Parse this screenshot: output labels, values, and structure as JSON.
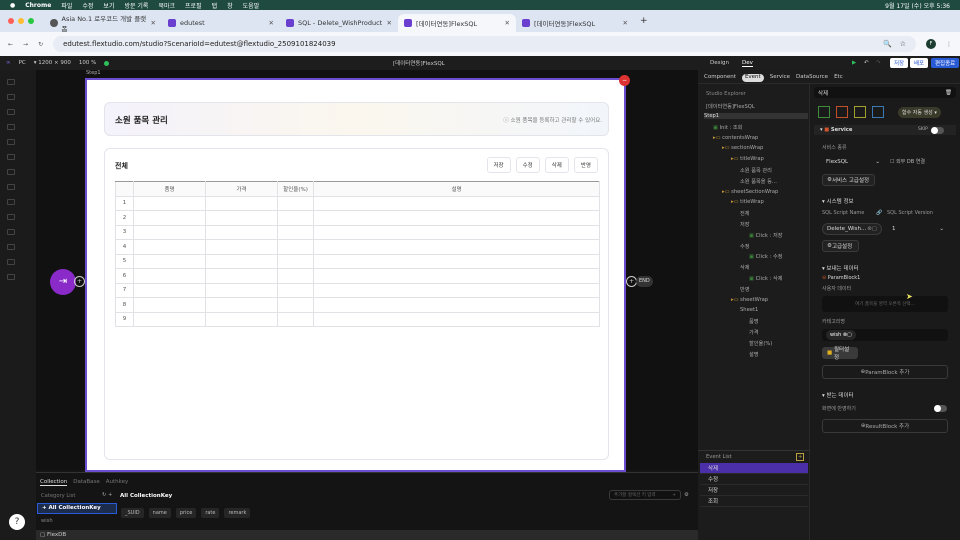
{
  "menubar": {
    "app": "Chrome",
    "items": [
      "파일",
      "수정",
      "보기",
      "방문 기록",
      "북마크",
      "프로필",
      "탭",
      "창",
      "도움말"
    ],
    "clock": "9월 17일 (수) 오후 5:36"
  },
  "tabs": [
    {
      "label": "Asia No.1 로우코드 개발 플랫폼"
    },
    {
      "label": "edutest"
    },
    {
      "label": "SQL - Delete_WishProduct"
    },
    {
      "label": "[데이터연동]FlexSQL",
      "active": true
    },
    {
      "label": "[데이터연동]FlexSQL"
    }
  ],
  "address": {
    "url": "edutest.flextudio.com/studio?ScenarioId=edutest@flextudio_2509101824039",
    "profile": "F"
  },
  "apptop": {
    "device": "PC",
    "resolution": "1200 × 900",
    "zoom": "100",
    "zoom_unit": "%",
    "title": "[데이터연동]FlexSQL",
    "mode_tabs": [
      "Design",
      "Dev"
    ],
    "active_mode": "Dev",
    "save": "저장",
    "deploy": "배포",
    "finish": "편집종료"
  },
  "canvas": {
    "step_label": "Step1",
    "end_label": "END"
  },
  "page": {
    "title": "소원 품목 관리",
    "subtitle": "소원 품목을 등록하고 관리할 수 있어요.",
    "section_title": "전체",
    "buttons": [
      "저장",
      "수정",
      "삭제",
      "반영"
    ],
    "columns": [
      "",
      "품명",
      "가격",
      "할인율(%)",
      "설명"
    ],
    "rows": [
      "1",
      "2",
      "3",
      "4",
      "5",
      "6",
      "7",
      "8",
      "9"
    ]
  },
  "bottom": {
    "tabs": [
      "Collection",
      "DataBase",
      "Authkey"
    ],
    "category_label": "Category List",
    "categories": [
      "All CollectionKey",
      "wish"
    ],
    "heading": "All CollectionKey",
    "fields": [
      "_SUID",
      "name",
      "price",
      "rate",
      "remark"
    ],
    "key_placeholder": "추가할 컬렉션 키 입력"
  },
  "footer": {
    "label": "FlexDB"
  },
  "explorer": {
    "tabs": [
      "Component",
      "Event",
      "Service",
      "DataSource",
      "Etc"
    ],
    "active_tab": "Event",
    "title": "Studio Explorer",
    "root": "[데이터연동]FlexSQL",
    "tree": [
      {
        "t": "Step1",
        "d": 0
      },
      {
        "t": "Init : 조회",
        "d": 1
      },
      {
        "t": "contentsWrap",
        "d": 1
      },
      {
        "t": "sectionWrap",
        "d": 2
      },
      {
        "t": "titleWrap",
        "d": 3
      },
      {
        "t": "소원 품목 관리",
        "d": 4
      },
      {
        "t": "소원 품목을 등...",
        "d": 4
      },
      {
        "t": "sheetSectionWrap",
        "d": 2
      },
      {
        "t": "titleWrap",
        "d": 3
      },
      {
        "t": "전체",
        "d": 4
      },
      {
        "t": "저장",
        "d": 4
      },
      {
        "t": "Click : 저장",
        "d": 5
      },
      {
        "t": "수정",
        "d": 4
      },
      {
        "t": "Click : 수정",
        "d": 5
      },
      {
        "t": "삭제",
        "d": 4
      },
      {
        "t": "Click : 삭제",
        "d": 5
      },
      {
        "t": "반영",
        "d": 4
      },
      {
        "t": "sheetWrap",
        "d": 3
      },
      {
        "t": "Sheet1",
        "d": 4
      },
      {
        "t": "품명",
        "d": 5
      },
      {
        "t": "가격",
        "d": 5
      },
      {
        "t": "할인율(%)",
        "d": 5
      },
      {
        "t": "설명",
        "d": 5
      }
    ],
    "event_list_title": "Event List",
    "events": [
      "삭제",
      "수정",
      "저장",
      "조회"
    ],
    "selected_event": "삭제"
  },
  "props": {
    "title": "삭제",
    "auto_func": "함수 자동 생성",
    "service": "Service",
    "skip": "SKIP",
    "service_type_label": "서비스 종류",
    "service_type": "FlexSQL",
    "external_db": "외부 DB 연결",
    "service_adv": "서비스 고급설정",
    "system_info": "시스템 정보",
    "script_name_label": "SQL Script Name",
    "script_version_label": "SQL Script Version",
    "script_name": "Delete_Wish...",
    "script_version": "1",
    "adv": "고급설정",
    "send_data": "보내는 데이터",
    "param_block": "ParamBlock1",
    "user_data": "사용자 데이터",
    "user_data_hint": "여기 품목을 영역 오른쪽 선택...",
    "category_label": "카테고리명",
    "category_chip": "wish",
    "filter": "필터설정",
    "add_param": "ParamBlock 추가",
    "recv_data": "받는 데이터",
    "reflect": "화면에 반영하기",
    "add_result": "ResultBlock 추가"
  },
  "colors": {
    "accent": "#6b4fd0",
    "primary": "#2a5bd7",
    "selected_event": "#4b2fa8",
    "menubar": "#1f4a40"
  }
}
